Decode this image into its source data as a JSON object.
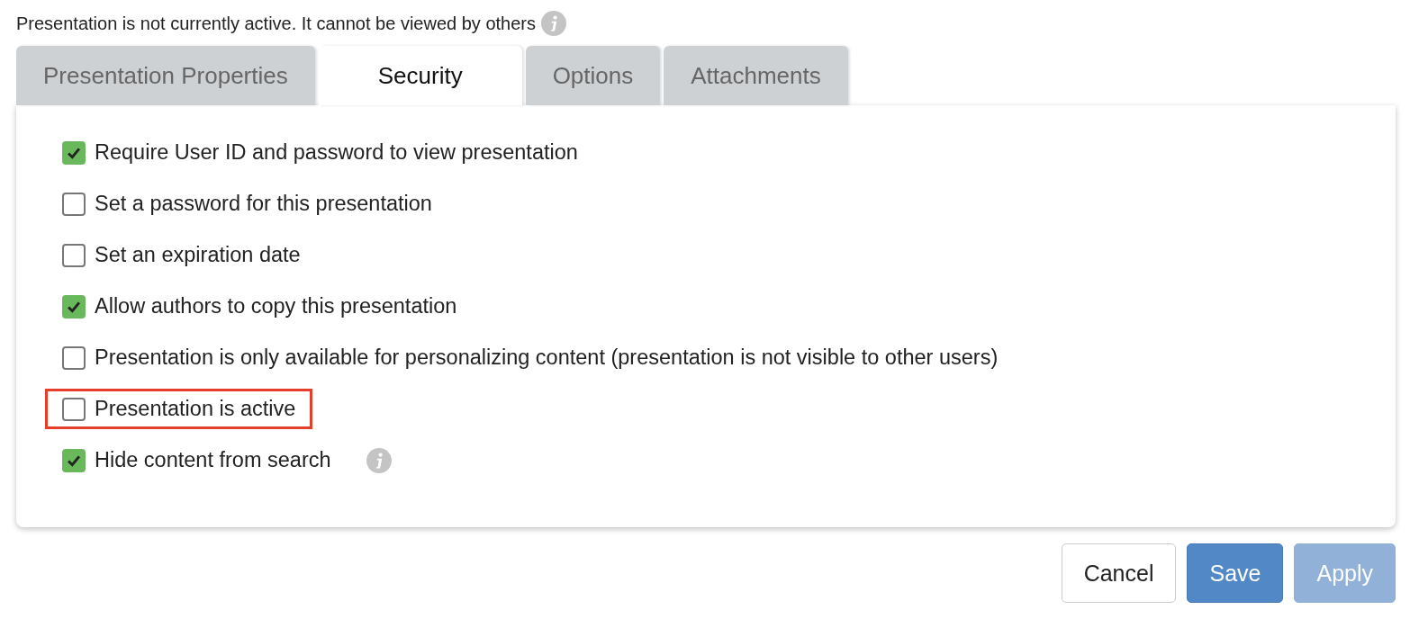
{
  "status": {
    "text": "Presentation is not currently active. It cannot be viewed by others",
    "info": true
  },
  "tabs": [
    {
      "label": "Presentation Properties",
      "selected": false
    },
    {
      "label": "Security",
      "selected": true
    },
    {
      "label": "Options",
      "selected": false
    },
    {
      "label": "Attachments",
      "selected": false
    }
  ],
  "options": [
    {
      "label": "Require User ID and password to view presentation",
      "checked": true,
      "highlighted": false,
      "info": false
    },
    {
      "label": "Set a password for this presentation",
      "checked": false,
      "highlighted": false,
      "info": false
    },
    {
      "label": "Set an expiration date",
      "checked": false,
      "highlighted": false,
      "info": false
    },
    {
      "label": "Allow authors to copy this presentation",
      "checked": true,
      "highlighted": false,
      "info": false
    },
    {
      "label": "Presentation is only available for personalizing content (presentation is not visible to other users)",
      "checked": false,
      "highlighted": false,
      "info": false
    },
    {
      "label": "Presentation is active",
      "checked": false,
      "highlighted": true,
      "info": false
    },
    {
      "label": "Hide content from search",
      "checked": true,
      "highlighted": false,
      "info": true
    }
  ],
  "buttons": [
    {
      "label": "Cancel",
      "kind": "default",
      "disabled": false
    },
    {
      "label": "Save",
      "kind": "primary",
      "disabled": false
    },
    {
      "label": "Apply",
      "kind": "primary",
      "disabled": true
    }
  ]
}
